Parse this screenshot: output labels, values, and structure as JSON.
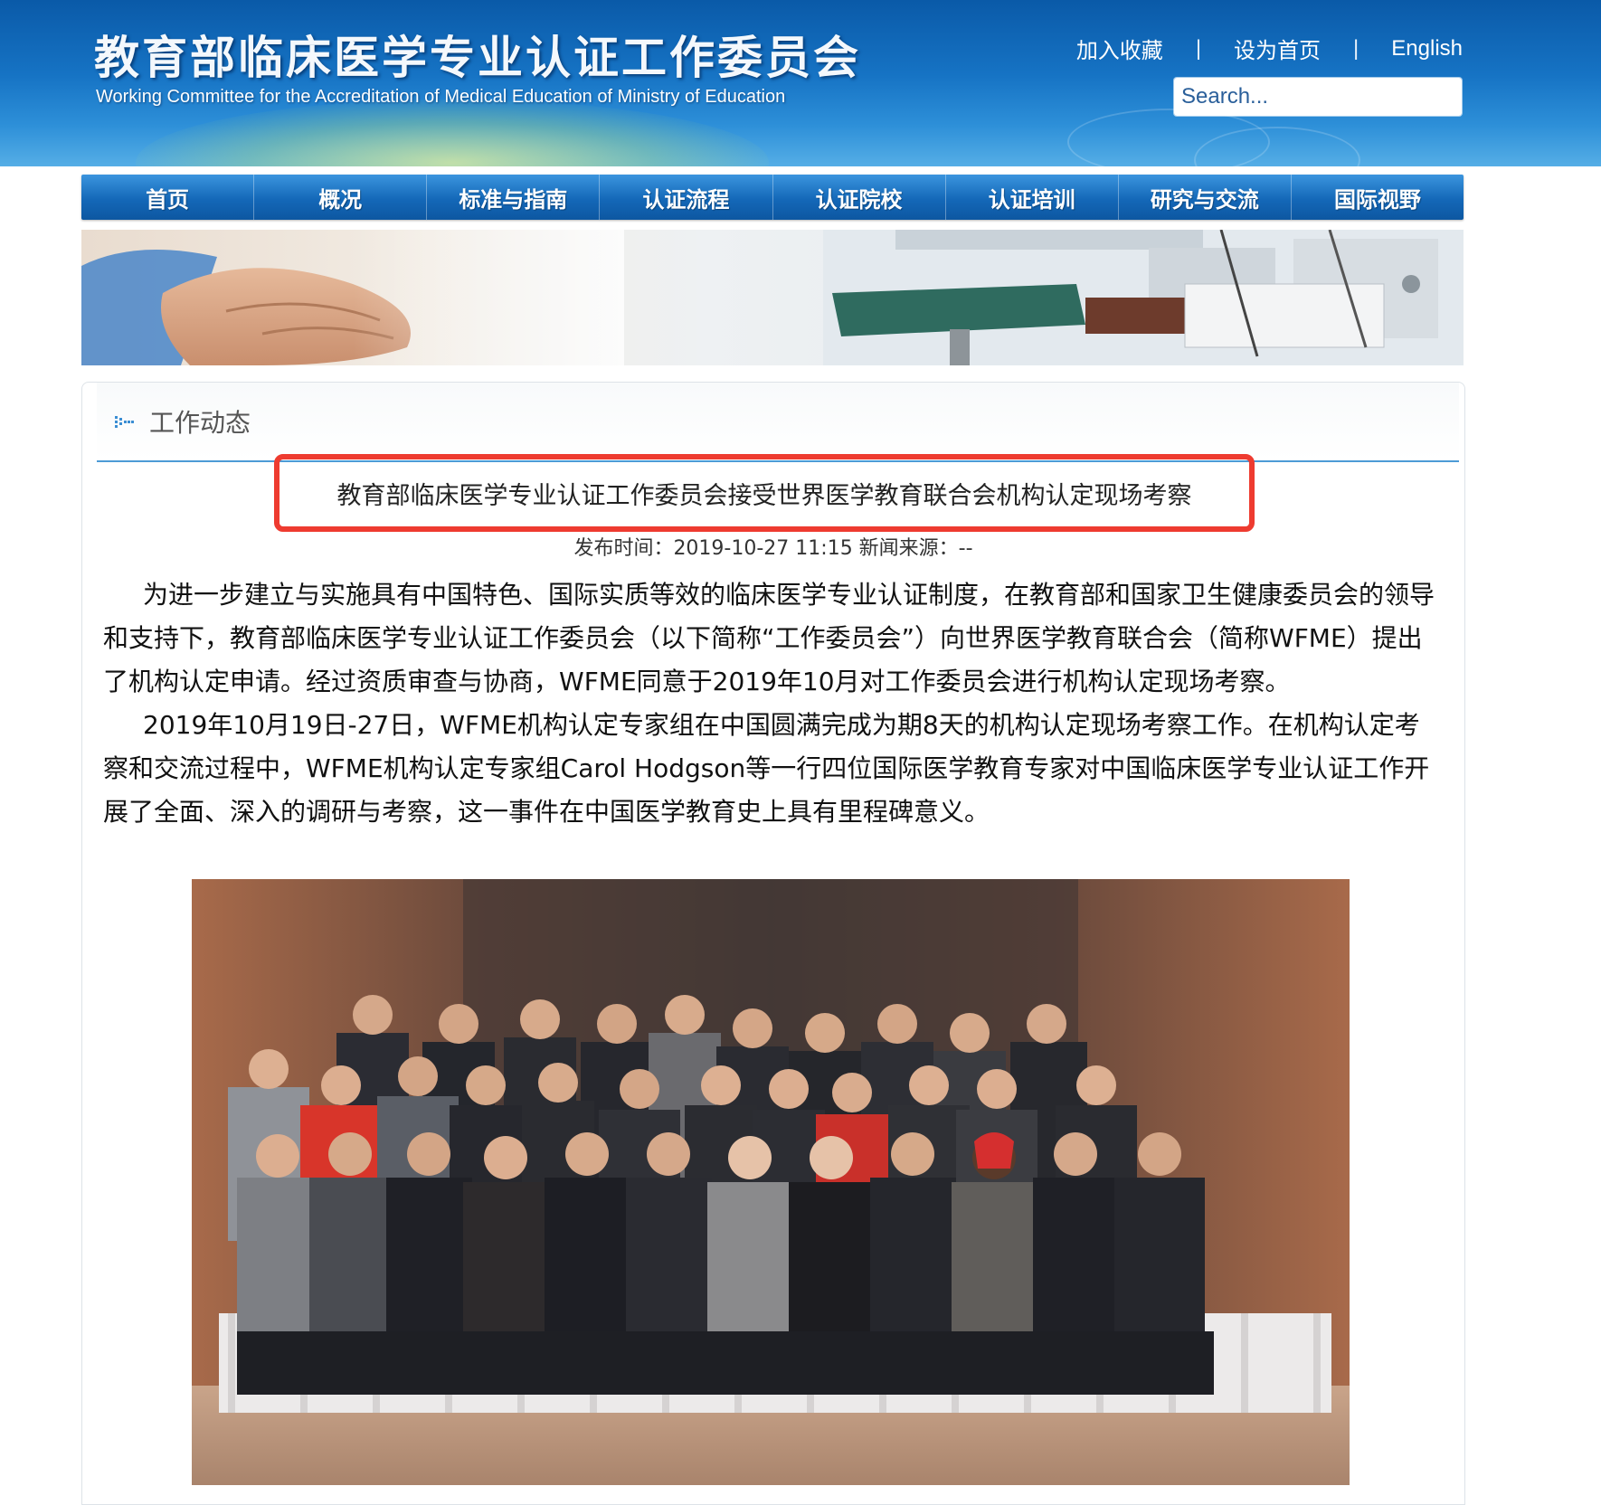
{
  "header": {
    "title": "教育部临床医学专业认证工作委员会",
    "subtitle": "Working Committee for the Accreditation of Medical Education of Ministry of Education",
    "links": {
      "bookmark": "加入收藏",
      "sep1": "|",
      "homepage": "设为首页",
      "sep2": "|",
      "english": "English"
    },
    "search": {
      "placeholder": "Search..."
    }
  },
  "nav": {
    "items": [
      "首页",
      "概况",
      "标准与指南",
      "认证流程",
      "认证院校",
      "认证培训",
      "研究与交流",
      "国际视野"
    ]
  },
  "panel": {
    "title": "工作动态"
  },
  "article": {
    "headline": "教育部临床医学专业认证工作委员会接受世界医学教育联合会机构认定现场考察",
    "meta": "发布时间：2019-10-27 11:15 新闻来源：--",
    "paragraphs": [
      "为进一步建立与实施具有中国特色、国际实质等效的临床医学专业认证制度，在教育部和国家卫生健康委员会的领导和支持下，教育部临床医学专业认证工作委员会（以下简称“工作委员会”）向世界医学教育联合会（简称WFME）提出了机构认定申请。经过资质审查与协商，WFME同意于2019年10月对工作委员会进行机构认定现场考察。",
      "2019年10月19日-27日，WFME机构认定专家组在中国圆满完成为期8天的机构认定现场考察工作。在机构认定考察和交流过程中，WFME机构认定专家组Carol Hodgson等一行四位国际医学教育专家对中国临床医学专业认证工作开展了全面、深入的调研与考察，这一事件在中国医学教育史上具有里程碑意义。"
    ]
  },
  "colors": {
    "header_blue": "#1673c4",
    "nav_blue": "#1468b8",
    "highlight_red": "#ee3b30",
    "panel_rule": "#4d9bd6"
  }
}
